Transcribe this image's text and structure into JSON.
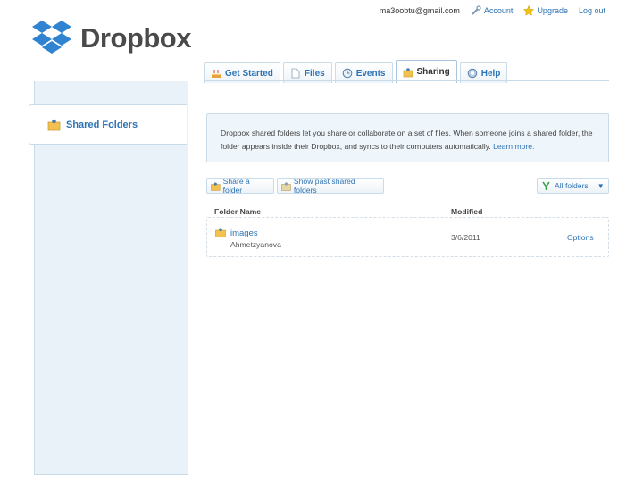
{
  "brand": {
    "name": "Dropbox"
  },
  "toplinks": {
    "email": "ma3oobtu@gmail.com",
    "account": "Account",
    "upgrade": "Upgrade",
    "logout": "Log out"
  },
  "tabs": [
    {
      "label": "Get Started",
      "icon": "cake-icon"
    },
    {
      "label": "Files",
      "icon": "file-icon"
    },
    {
      "label": "Events",
      "icon": "clock-icon"
    },
    {
      "label": "Sharing",
      "icon": "shared-folder-icon",
      "active": true
    },
    {
      "label": "Help",
      "icon": "help-icon"
    }
  ],
  "sidebar": {
    "items": [
      {
        "label": "Shared Folders",
        "icon": "shared-folder-icon"
      }
    ]
  },
  "info": {
    "text": "Dropbox shared folders let you share or collaborate on a set of files. When someone joins a shared folder, the folder appears inside their Dropbox, and syncs to their computers automatically.",
    "learn_more": "Learn more."
  },
  "actions": {
    "share": "Share a folder",
    "past": "Show past shared folders",
    "filter": "All folders"
  },
  "table": {
    "headers": {
      "name": "Folder Name",
      "modified": "Modified"
    },
    "rows": [
      {
        "name": "images",
        "owner": "Ahmetzyanova",
        "modified": "3/6/2011",
        "options": "Options"
      }
    ]
  },
  "colors": {
    "link": "#2d73b4",
    "panel": "#e9f1f9",
    "border": "#c8dbe9",
    "logo_blue": "#2f83d0"
  }
}
